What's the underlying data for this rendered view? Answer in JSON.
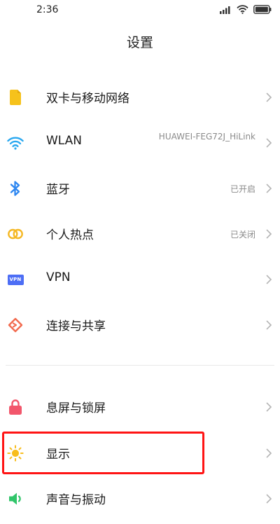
{
  "status_bar": {
    "time": "2:36",
    "icons": [
      "signal-icon",
      "wifi-icon",
      "battery-icon"
    ]
  },
  "header": {
    "title": "设置"
  },
  "settings": {
    "items": [
      {
        "label": "双卡与移动网络",
        "value": "",
        "icon": "sim-card-icon",
        "icon_color": "#f6c21b"
      },
      {
        "label": "WLAN",
        "value": "HUAWEI-FEG72J_HiLink",
        "icon": "wifi-icon",
        "icon_color": "#2aa8f0"
      },
      {
        "label": "蓝牙",
        "value": "已开启",
        "icon": "bluetooth-icon",
        "icon_color": "#2d86f0"
      },
      {
        "label": "个人热点",
        "value": "已关闭",
        "icon": "hotspot-icon",
        "icon_color": "#f5b824"
      },
      {
        "label": "VPN",
        "value": "",
        "icon": "vpn-icon",
        "icon_color": "#4d6ef5",
        "icon_text": "VPN"
      },
      {
        "label": "连接与共享",
        "value": "",
        "icon": "connection-share-icon",
        "icon_color": "#f26b4f"
      },
      {
        "label": "息屏与锁屏",
        "value": "",
        "icon": "lock-icon",
        "icon_color": "#f2566b"
      },
      {
        "label": "显示",
        "value": "",
        "icon": "brightness-icon",
        "icon_color": "#f8bd1c"
      },
      {
        "label": "声音与振动",
        "value": "",
        "icon": "speaker-icon",
        "icon_color": "#30c56a"
      }
    ]
  },
  "colors": {
    "highlight": "#ff1414",
    "chevron": "#b5b5b5",
    "secondary_text": "#8a8a8a"
  }
}
